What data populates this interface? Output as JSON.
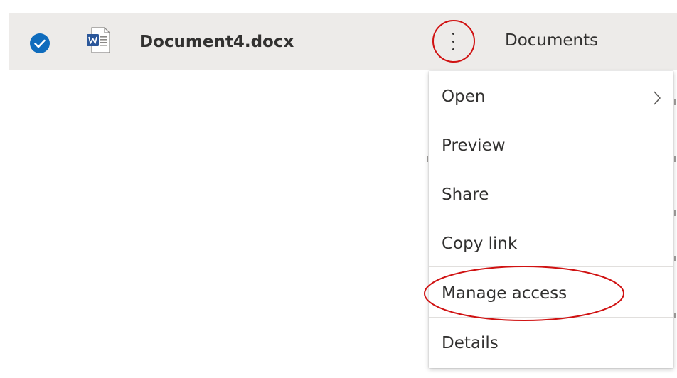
{
  "file_row": {
    "selected": true,
    "check_icon": "checkmark-circle-icon",
    "file_type_icon": "word-document-icon",
    "file_name": "Document4.docx",
    "more_icon": "more-vertical-icon",
    "location": "Documents"
  },
  "context_menu": {
    "items": [
      {
        "label": "Open",
        "has_submenu": true,
        "submenu_icon": "chevron-right-icon"
      },
      {
        "label": "Preview"
      },
      {
        "label": "Share"
      },
      {
        "label": "Copy link"
      },
      {
        "label": "Manage access"
      },
      {
        "label": "Details"
      }
    ]
  },
  "colors": {
    "accent": "#0f6cbd",
    "row_selected_bg": "#edebe9",
    "annotation_red": "#d01212",
    "text": "#323130",
    "word_blue": "#2b579a"
  }
}
